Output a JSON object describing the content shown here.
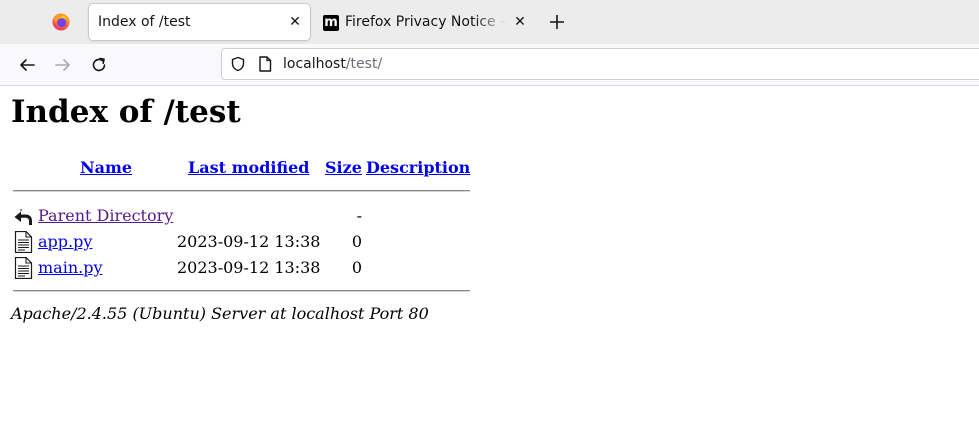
{
  "browser": {
    "tabs": [
      {
        "title": "Index of /test",
        "active": true
      },
      {
        "title": "Firefox Privacy Notice — Mozilla",
        "favicon_letter": "m",
        "active": false
      }
    ],
    "tab_close_glyph": "✕",
    "new_tab_icon": "plus-icon",
    "url": {
      "host": "localhost",
      "path": "/test/"
    }
  },
  "page": {
    "title": "Index of /test",
    "columns": {
      "name": "Name",
      "modified": "Last modified",
      "size": "Size",
      "description": "Description"
    },
    "rows": [
      {
        "name": "Parent Directory",
        "modified": "",
        "size": "-",
        "icon": "back-arrow-icon",
        "visited": true
      },
      {
        "name": "app.py",
        "modified": "2023-09-12 13:38",
        "size": "0",
        "icon": "text-file-icon",
        "visited": false
      },
      {
        "name": "main.py",
        "modified": "2023-09-12 13:38",
        "size": "0",
        "icon": "text-file-icon",
        "visited": false
      }
    ],
    "footer": "Apache/2.4.55 (Ubuntu) Server at localhost Port 80"
  },
  "colors": {
    "link": "#0000ee",
    "visited_link": "#551a8b",
    "tabbar": "#ececec",
    "navbar": "#f9f9fb"
  }
}
